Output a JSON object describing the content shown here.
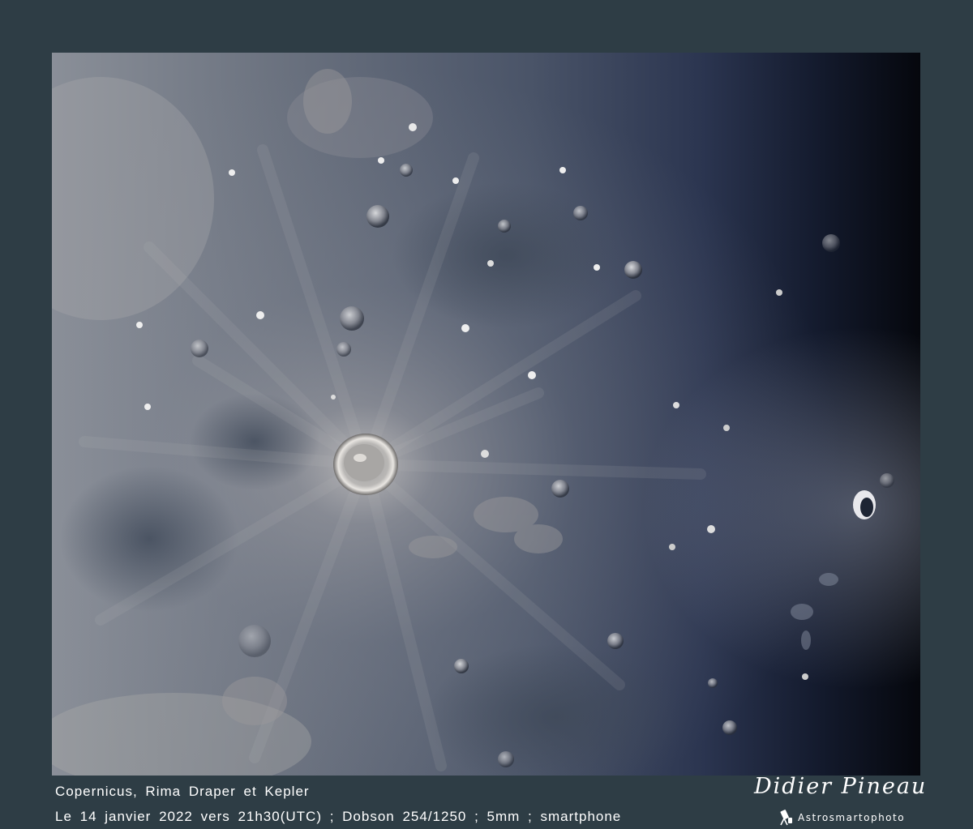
{
  "caption": {
    "title": "Copernicus, Rima Draper et Kepler",
    "details": "Le 14 janvier 2022 vers 21h30(UTC) ; Dobson 254/1250 ; 5mm ; smartphone"
  },
  "signature": {
    "name": "Didier Pineau",
    "brand": "Astrosmartophoto"
  },
  "colors": {
    "background": "#2e3d45",
    "terminator": "#05070d",
    "lunar_surface": "#6b7482",
    "caption_text": "#ffffff"
  },
  "icons": [
    "telescope-icon"
  ]
}
